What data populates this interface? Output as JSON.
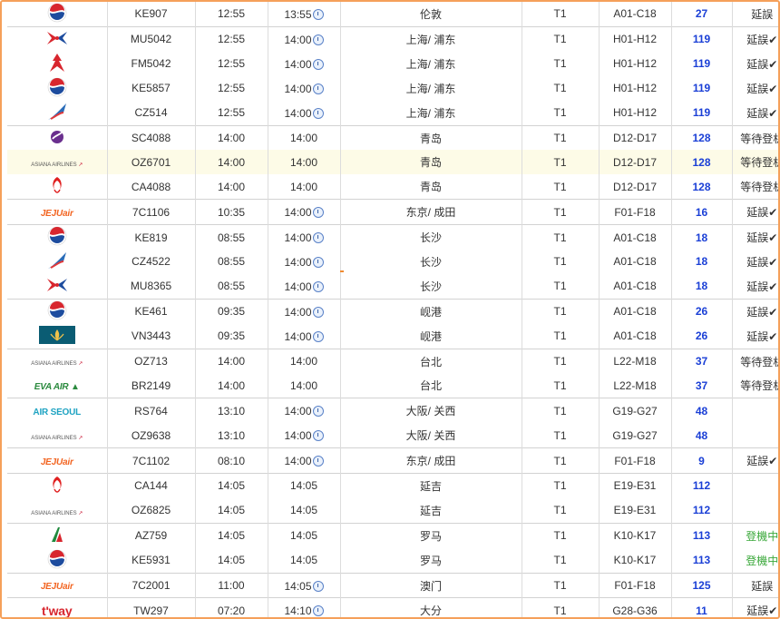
{
  "colors": {
    "gate": "#1a3fd6",
    "delay_check": "#e0241b",
    "boarding": "#3aa83a",
    "frame_border": "#f5a05a"
  },
  "flights": [
    {
      "logo": "korean-air",
      "flight": "KE907",
      "sched": "12:55",
      "est": "13:55",
      "clock": true,
      "dest": "伦敦",
      "term": "T1",
      "counter": "A01-C18",
      "gate": "27",
      "status": "延誤",
      "check": false,
      "status_type": "delay"
    },
    {
      "logo": "china-eastern",
      "flight": "MU5042",
      "sched": "12:55",
      "est": "14:00",
      "clock": true,
      "dest": "上海/ 浦东",
      "term": "T1",
      "counter": "H01-H12",
      "gate": "119",
      "status": "延誤",
      "check": true,
      "status_type": "delay"
    },
    {
      "logo": "shanghai-airlines",
      "flight": "FM5042",
      "sched": "12:55",
      "est": "14:00",
      "clock": true,
      "dest": "上海/ 浦东",
      "term": "T1",
      "counter": "H01-H12",
      "gate": "119",
      "status": "延誤",
      "check": true,
      "status_type": "delay"
    },
    {
      "logo": "korean-air",
      "flight": "KE5857",
      "sched": "12:55",
      "est": "14:00",
      "clock": true,
      "dest": "上海/ 浦东",
      "term": "T1",
      "counter": "H01-H12",
      "gate": "119",
      "status": "延誤",
      "check": true,
      "status_type": "delay"
    },
    {
      "logo": "china-southern",
      "flight": "CZ514",
      "sched": "12:55",
      "est": "14:00",
      "clock": true,
      "dest": "上海/ 浦东",
      "term": "T1",
      "counter": "H01-H12",
      "gate": "119",
      "status": "延誤",
      "check": true,
      "status_type": "delay"
    },
    {
      "logo": "shandong-airlines",
      "flight": "SC4088",
      "sched": "14:00",
      "est": "14:00",
      "clock": false,
      "dest": "青岛",
      "term": "T1",
      "counter": "D12-D17",
      "gate": "128",
      "status": "等待登机",
      "check": false,
      "status_type": "wait"
    },
    {
      "logo": "asiana",
      "flight": "OZ6701",
      "sched": "14:00",
      "est": "14:00",
      "clock": false,
      "dest": "青岛",
      "term": "T1",
      "counter": "D12-D17",
      "gate": "128",
      "status": "等待登机",
      "check": false,
      "status_type": "wait"
    },
    {
      "logo": "air-china",
      "flight": "CA4088",
      "sched": "14:00",
      "est": "14:00",
      "clock": false,
      "dest": "青岛",
      "term": "T1",
      "counter": "D12-D17",
      "gate": "128",
      "status": "等待登机",
      "check": false,
      "status_type": "wait"
    },
    {
      "logo": "jeju-air",
      "flight": "7C1106",
      "sched": "10:35",
      "est": "14:00",
      "clock": true,
      "dest": "东京/ 成田",
      "term": "T1",
      "counter": "F01-F18",
      "gate": "16",
      "status": "延誤",
      "check": true,
      "status_type": "delay"
    },
    {
      "logo": "korean-air",
      "flight": "KE819",
      "sched": "08:55",
      "est": "14:00",
      "clock": true,
      "dest": "长沙",
      "term": "T1",
      "counter": "A01-C18",
      "gate": "18",
      "status": "延誤",
      "check": true,
      "status_type": "delay"
    },
    {
      "logo": "china-southern",
      "flight": "CZ4522",
      "sched": "08:55",
      "est": "14:00",
      "clock": true,
      "dest": "长沙",
      "term": "T1",
      "counter": "A01-C18",
      "gate": "18",
      "status": "延誤",
      "check": true,
      "status_type": "delay"
    },
    {
      "logo": "china-eastern",
      "flight": "MU8365",
      "sched": "08:55",
      "est": "14:00",
      "clock": true,
      "dest": "长沙",
      "term": "T1",
      "counter": "A01-C18",
      "gate": "18",
      "status": "延誤",
      "check": true,
      "status_type": "delay"
    },
    {
      "logo": "korean-air",
      "flight": "KE461",
      "sched": "09:35",
      "est": "14:00",
      "clock": true,
      "dest": "岘港",
      "term": "T1",
      "counter": "A01-C18",
      "gate": "26",
      "status": "延誤",
      "check": true,
      "status_type": "delay"
    },
    {
      "logo": "vietnam-airlines",
      "flight": "VN3443",
      "sched": "09:35",
      "est": "14:00",
      "clock": true,
      "dest": "岘港",
      "term": "T1",
      "counter": "A01-C18",
      "gate": "26",
      "status": "延誤",
      "check": true,
      "status_type": "delay"
    },
    {
      "logo": "asiana",
      "flight": "OZ713",
      "sched": "14:00",
      "est": "14:00",
      "clock": false,
      "dest": "台北",
      "term": "T1",
      "counter": "L22-M18",
      "gate": "37",
      "status": "等待登机",
      "check": false,
      "status_type": "wait"
    },
    {
      "logo": "eva-air",
      "flight": "BR2149",
      "sched": "14:00",
      "est": "14:00",
      "clock": false,
      "dest": "台北",
      "term": "T1",
      "counter": "L22-M18",
      "gate": "37",
      "status": "等待登机",
      "check": false,
      "status_type": "wait"
    },
    {
      "logo": "air-seoul",
      "flight": "RS764",
      "sched": "13:10",
      "est": "14:00",
      "clock": true,
      "dest": "大阪/ 关西",
      "term": "T1",
      "counter": "G19-G27",
      "gate": "48",
      "status": "",
      "check": false,
      "status_type": "none"
    },
    {
      "logo": "asiana",
      "flight": "OZ9638",
      "sched": "13:10",
      "est": "14:00",
      "clock": true,
      "dest": "大阪/ 关西",
      "term": "T1",
      "counter": "G19-G27",
      "gate": "48",
      "status": "",
      "check": false,
      "status_type": "none"
    },
    {
      "logo": "jeju-air",
      "flight": "7C1102",
      "sched": "08:10",
      "est": "14:00",
      "clock": true,
      "dest": "东京/ 成田",
      "term": "T1",
      "counter": "F01-F18",
      "gate": "9",
      "status": "延誤",
      "check": true,
      "status_type": "delay"
    },
    {
      "logo": "air-china",
      "flight": "CA144",
      "sched": "14:05",
      "est": "14:05",
      "clock": false,
      "dest": "延吉",
      "term": "T1",
      "counter": "E19-E31",
      "gate": "112",
      "status": "",
      "check": false,
      "status_type": "none"
    },
    {
      "logo": "asiana",
      "flight": "OZ6825",
      "sched": "14:05",
      "est": "14:05",
      "clock": false,
      "dest": "延吉",
      "term": "T1",
      "counter": "E19-E31",
      "gate": "112",
      "status": "",
      "check": false,
      "status_type": "none"
    },
    {
      "logo": "alitalia",
      "flight": "AZ759",
      "sched": "14:05",
      "est": "14:05",
      "clock": false,
      "dest": "罗马",
      "term": "T1",
      "counter": "K10-K17",
      "gate": "113",
      "status": "登機中",
      "check": false,
      "status_type": "boarding"
    },
    {
      "logo": "korean-air",
      "flight": "KE5931",
      "sched": "14:05",
      "est": "14:05",
      "clock": false,
      "dest": "罗马",
      "term": "T1",
      "counter": "K10-K17",
      "gate": "113",
      "status": "登機中",
      "check": false,
      "status_type": "boarding"
    },
    {
      "logo": "jeju-air",
      "flight": "7C2001",
      "sched": "11:00",
      "est": "14:05",
      "clock": true,
      "dest": "澳门",
      "term": "T1",
      "counter": "F01-F18",
      "gate": "125",
      "status": "延誤",
      "check": false,
      "status_type": "delay"
    },
    {
      "logo": "tway",
      "flight": "TW297",
      "sched": "07:20",
      "est": "14:10",
      "clock": true,
      "dest": "大分",
      "term": "T1",
      "counter": "G28-G36",
      "gate": "11",
      "status": "延誤",
      "check": true,
      "status_type": "delay"
    }
  ],
  "logo_text": {
    "asiana": "ASIANA AIRLINES",
    "jeju": "JEJUair",
    "eva": "EVA AIR",
    "airseoul": "AIR SEOUL",
    "tway": "t'way"
  }
}
